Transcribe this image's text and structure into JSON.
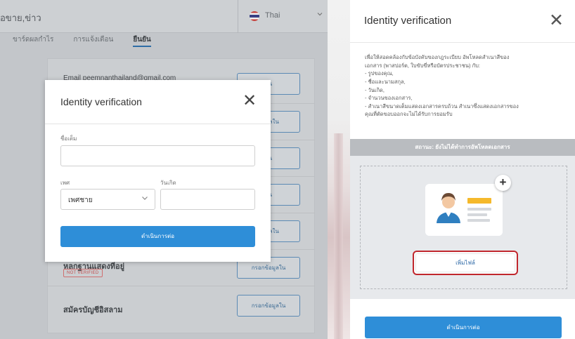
{
  "left": {
    "header": {
      "brand_fragment": "ื่อขาย,ข่าว",
      "language": "Thai"
    },
    "tabs": [
      {
        "label": "ขาร์ดผลกำไร",
        "active": false
      },
      {
        "label": "การแจ้งเตือน",
        "active": false
      },
      {
        "label": "ยืนยัน",
        "active": true
      }
    ],
    "verification_rows": {
      "email_text": "Email peemnanthailand@gmail.com",
      "row_title_partial": "หลกฐานแสดงที่อยู่",
      "not_verified_badge": "NOT VERIFIED",
      "row_title_islamic": "สมัครบัญชีอิสลาม",
      "fill_button_label": "กรอกข้อมูลใน",
      "fill_button_partial": "ข้อมูลใน",
      "edit_button_partial": "ยัน"
    },
    "modal": {
      "title": "Identity verification",
      "close_symbol": "✕",
      "full_name_label": "ชื่อเต็ม",
      "full_name_value": "",
      "gender_label": "เพศ",
      "gender_value": "เพศชาย",
      "birth_date_label": "วันเกิด",
      "birth_date_value": "",
      "continue_button": "ดำเนินการต่อ"
    }
  },
  "right": {
    "title": "Identity verification",
    "close_symbol": "✕",
    "intro_lines": [
      "เพื่อให้สอดคล้องกับข้อบังคับของกฎระเบียบ อัพโหลดสำเนาสีของ",
      "เอกสาร (พาสปอร์ต, ใบขับขี่หรือบัตรประชาชน) กับ:",
      "- รูปของคุณ,",
      "- ชื่อและนามสกุล,",
      "- วันเกิด,",
      "- จำนวนของเอกสาร,",
      "- สำเนาสีขนาดเต็มแสดงเอกสารครบถ้วน สำเนาซึ่งแสดงเอกสารของ",
      "คุณที่ตัดขอบออกจะไม่ได้รับการยอมรับ"
    ],
    "status_text": "สถานะ: ยังไม่ได้ทำการอัพโหลดเอกสาร",
    "plus_symbol": "+",
    "add_file_button": "เพิ่มไฟล์",
    "continue_button": "ดำเนินการต่อ"
  },
  "colors": {
    "primary_button": "#2e8ed8",
    "highlight_outline": "#c0272d",
    "overlay_gray": "#c3c6ca",
    "badge_red": "#c44e4e"
  },
  "icons": {
    "flag": "thailand-flag-icon",
    "chevron": "chevron-down-icon",
    "close": "close-icon",
    "plus": "plus-icon",
    "id_card": "id-card-icon"
  }
}
